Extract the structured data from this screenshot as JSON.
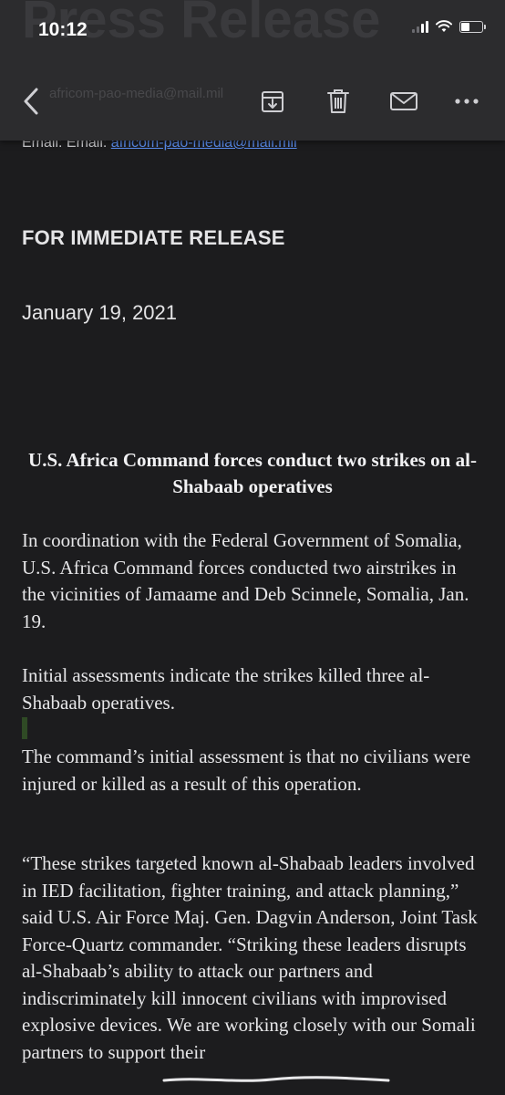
{
  "status_bar": {
    "time": "10:12"
  },
  "header_ghost": {
    "title": "Press Release",
    "email_peek": "africom-pao-media@mail.mil"
  },
  "toolbar": {
    "back_icon": "chevron-left-icon",
    "archive_icon": "archive-icon",
    "trash_icon": "trash-icon",
    "mail_icon": "envelope-icon",
    "more_icon": "ellipsis-icon"
  },
  "email": {
    "contact_prefix": "Email: Email: ",
    "contact_link": "africom-pao-media@mail.mil",
    "release_label": "FOR IMMEDIATE RELEASE",
    "date": "January 19, 2021",
    "headline": "U.S. Africa Command forces conduct two strikes on al-Shabaab operatives",
    "paragraphs": [
      "In coordination with the Federal Government of Somalia, U.S. Africa Command forces conducted two airstrikes in the vicinities of Jamaame and Deb Scinnele, Somalia, Jan. 19.",
      "Initial assessments indicate the strikes killed three al-Shabaab operatives.",
      "The command’s initial assessment is that no civilians were injured or killed as a result of this operation.",
      "“These strikes targeted known al-Shabaab leaders involved in IED facilitation, fighter training, and attack planning,” said U.S. Air Force Maj. Gen. Dagvin Anderson, Joint Task Force-Quartz commander. “Striking these leaders disrupts al-Shabaab’s ability to attack our partners and indiscriminately kill innocent civilians with improvised explosive devices. We are working closely with our Somali partners to support their"
    ]
  },
  "colors": {
    "background": "#1c1c1e",
    "toolbar": "#2c2c2e",
    "link": "#5a8dee",
    "text": "#e6e6e8"
  }
}
